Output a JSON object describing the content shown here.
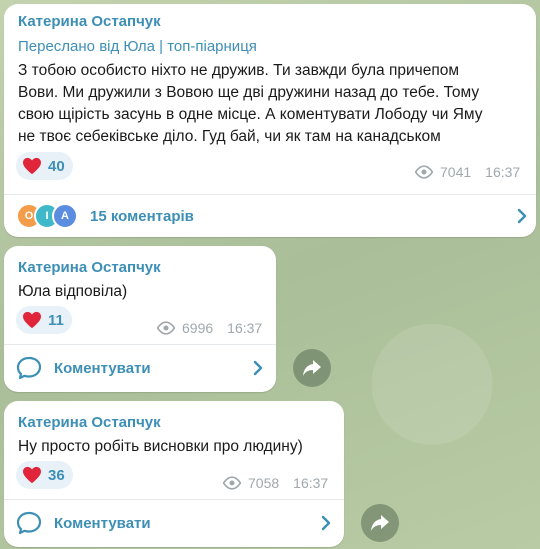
{
  "messages": [
    {
      "sender": "Катерина Остапчук",
      "forwarded": "Переслано від Юла | топ-піарниця",
      "text_lines": [
        "З тобою особисто ніхто не дружив. Ти завжди була причепом",
        "Вови. Ми дружили з Вовою ще дві дружини назад до тебе. Тому",
        "свою щірість засунь в одне місце. А коментувати Лободу чи Яму",
        "не твоє себеківське діло. Гуд бай, чи як там на канадськом"
      ],
      "reaction_count": "40",
      "views": "7041",
      "time": "16:37",
      "comments_label": "15 коментарів",
      "comment_avatars": [
        "O",
        "I",
        "A"
      ],
      "avatar_colors": [
        "#f39c4a",
        "#3fb8c9",
        "#5a8de0"
      ]
    },
    {
      "sender": "Катерина Остапчук",
      "text_lines": [
        "Юла відповіла)"
      ],
      "reaction_count": "11",
      "views": "6996",
      "time": "16:37",
      "comments_label": "Коментувати"
    },
    {
      "sender": "Катерина Остапчук",
      "text_lines": [
        "Ну просто робіть висновки про людину)"
      ],
      "reaction_count": "36",
      "views": "7058",
      "time": "16:37",
      "comments_label": "Коментувати"
    }
  ],
  "colors": {
    "accent": "#3d8fb5",
    "heart": "#e0243a",
    "meta": "#a0a8ad"
  }
}
